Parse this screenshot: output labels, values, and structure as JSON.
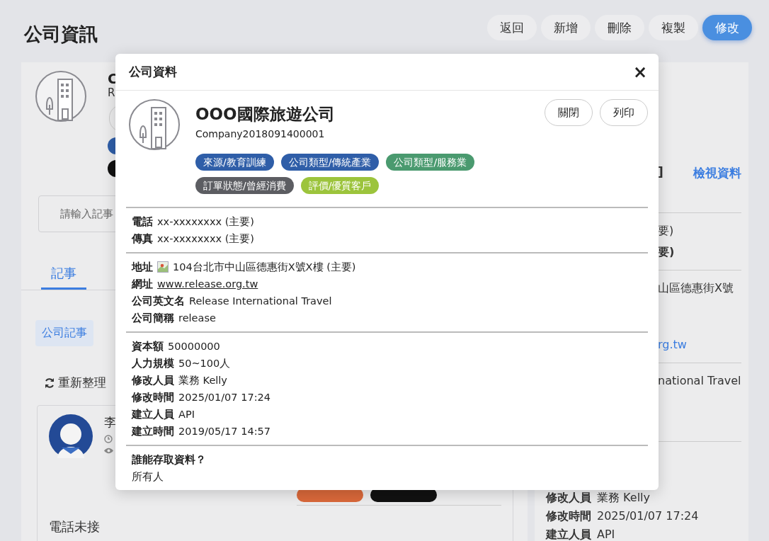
{
  "page": {
    "title": "公司資訊"
  },
  "header_buttons": [
    {
      "label": "返回",
      "kind": "default"
    },
    {
      "label": "新增",
      "kind": "default"
    },
    {
      "label": "刪除",
      "kind": "default"
    },
    {
      "label": "複製",
      "kind": "default"
    },
    {
      "label": "修改",
      "kind": "primary"
    }
  ],
  "company_card": {
    "name": "C",
    "code": "R",
    "tag_colors": [
      {
        "color": "#2f5ea8"
      },
      {
        "color": "#111111"
      }
    ],
    "note_input": {
      "placeholder": "請輸入記事"
    },
    "tabs": [
      {
        "label": "記事",
        "selected": true
      }
    ],
    "filters": [
      {
        "label": "公司記事",
        "selected": true
      }
    ],
    "refresh": "重新整理",
    "note": {
      "author": "李",
      "tags": [
        {
          "color": "#d9683a"
        },
        {
          "color": "#111111"
        }
      ],
      "body": "電話未接"
    }
  },
  "info_panel": {
    "bracket": "]",
    "view_link": "檢視資料",
    "groups": [
      [
        {
          "kind": "tail",
          "text": "要)"
        },
        {
          "kind": "tail_bold",
          "text": "要)"
        }
      ],
      [
        {
          "kind": "tail",
          "text": "山區德惠街X號"
        },
        {
          "kind": "link_tail",
          "text": "rg.tw"
        }
      ],
      [
        {
          "kind": "tail",
          "text": "national Travel"
        }
      ],
      [
        {
          "kind": "row",
          "label": "修改人員",
          "value": "業務 Kelly"
        },
        {
          "kind": "row",
          "label": "修改時間",
          "value": "2025/01/07 17:24"
        },
        {
          "kind": "row",
          "label": "建立人員",
          "value": "API"
        }
      ]
    ]
  },
  "modal": {
    "title": "公司資料",
    "close": "×",
    "name": "OOO國際旅遊公司",
    "code": "Company2018091400001",
    "buttons": [
      "關閉",
      "列印"
    ],
    "tags": [
      {
        "label": "來源/教育訓練",
        "color": "#2f5ea8"
      },
      {
        "label": "公司類型/傳統產業",
        "color": "#2f5ea8"
      },
      {
        "label": "公司類型/服務業",
        "color": "#4a9a6f"
      },
      {
        "label": "訂單狀態/曾經消費",
        "color": "#5c5d62"
      },
      {
        "label": "評價/優質客戶",
        "color": "#9cc43c"
      }
    ],
    "sections": [
      [
        {
          "kind": "text",
          "label": "電話",
          "value": "xx-xxxxxxxx (主要)"
        },
        {
          "kind": "text",
          "label": "傳真",
          "value": "xx-xxxxxxxx (主要)"
        }
      ],
      [
        {
          "kind": "address",
          "label": "地址",
          "value": "104台北市中山區德惠街X號X樓 (主要)"
        },
        {
          "kind": "link",
          "label": "網址",
          "value": "www.release.org.tw"
        },
        {
          "kind": "text",
          "label": "公司英文名",
          "value": "Release International Travel"
        },
        {
          "kind": "text",
          "label": "公司簡稱",
          "value": "release"
        }
      ],
      [
        {
          "kind": "text",
          "label": "資本額",
          "value": "50000000"
        },
        {
          "kind": "text",
          "label": "人力規模",
          "value": "50~100人"
        },
        {
          "kind": "text",
          "label": "修改人員",
          "value": "業務 Kelly"
        },
        {
          "kind": "text",
          "label": "修改時間",
          "value": "2025/01/07 17:24"
        },
        {
          "kind": "text",
          "label": "建立人員",
          "value": "API"
        },
        {
          "kind": "text",
          "label": "建立時間",
          "value": "2019/05/17 14:57"
        }
      ]
    ],
    "access": {
      "question": "誰能存取資料？",
      "answer": "所有人"
    }
  }
}
